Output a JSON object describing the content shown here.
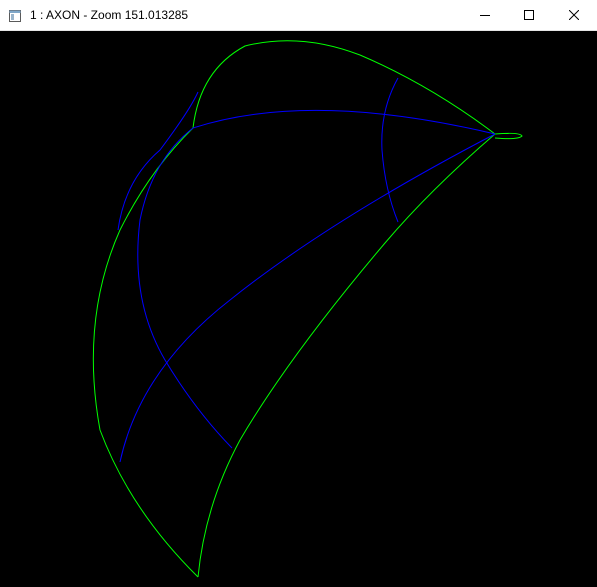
{
  "window": {
    "title": "1 : AXON - Zoom 151.013285",
    "icon": "application-window-icon",
    "buttons": {
      "minimize": "minimize-icon",
      "maximize": "maximize-icon",
      "close": "close-icon"
    }
  },
  "canvas": {
    "background": "#000000",
    "outline_color": "#00ff00",
    "interior_curve_color": "#0000ff"
  }
}
